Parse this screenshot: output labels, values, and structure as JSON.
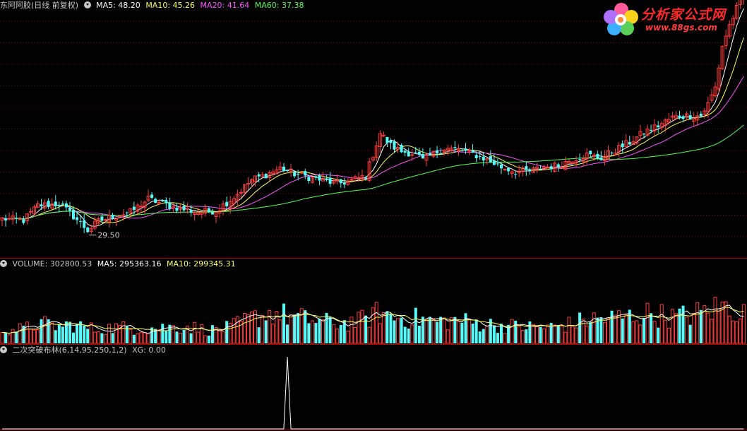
{
  "header1": {
    "title": "东阿阿胶(日线 前复权)",
    "ma5": "MA5: 48.20",
    "ma10": "MA10: 45.26",
    "ma20": "MA20: 41.64",
    "ma60": "MA60: 37.38"
  },
  "header2": {
    "volume": "VOLUME: 302800.53",
    "ma5": "MA5: 295363.16",
    "ma10": "MA10: 299345.31"
  },
  "header3": {
    "name": "二次突破布林(6,14,95,250,1,2)",
    "xg": "XG: 0.00"
  },
  "logo": {
    "title": "分析家公式网",
    "url": "www.88gs.com"
  },
  "colors": {
    "up": "#ff3c3c",
    "down": "#54fcfc",
    "ma5": "#ffffff",
    "ma10": "#ffff54",
    "ma20": "#ff54ff",
    "ma60": "#54ff54",
    "grid": "#8b0000",
    "divider": "#b00000"
  },
  "chart_data": {
    "type": "candlestick",
    "low_annotation": "29.50",
    "price_axis_range": [
      26.5,
      56.0
    ],
    "volume_axis_range": [
      0,
      750000
    ],
    "indicator_axis_range": [
      0,
      1
    ],
    "anchors": {
      "close": [
        [
          0,
          31.2
        ],
        [
          6,
          31.0
        ],
        [
          10,
          32.8
        ],
        [
          16,
          33.0
        ],
        [
          20,
          31.5
        ],
        [
          24,
          29.8
        ],
        [
          27,
          30.9
        ],
        [
          32,
          31.6
        ],
        [
          36,
          32.0
        ],
        [
          41,
          33.6
        ],
        [
          45,
          33.0
        ],
        [
          50,
          32.4
        ],
        [
          55,
          32.0
        ],
        [
          60,
          32.2
        ],
        [
          65,
          33.8
        ],
        [
          70,
          35.9
        ],
        [
          74,
          36.5
        ],
        [
          78,
          37.3
        ],
        [
          82,
          36.6
        ],
        [
          86,
          36.2
        ],
        [
          90,
          35.8
        ],
        [
          94,
          35.4
        ],
        [
          98,
          35.8
        ],
        [
          102,
          36.4
        ],
        [
          106,
          41.5
        ],
        [
          109,
          40.0
        ],
        [
          112,
          39.3
        ],
        [
          116,
          39.0
        ],
        [
          118,
          38.2
        ],
        [
          121,
          39.0
        ],
        [
          124,
          39.7
        ],
        [
          128,
          39.5
        ],
        [
          132,
          39.0
        ],
        [
          136,
          38.3
        ],
        [
          140,
          37.4
        ],
        [
          144,
          36.9
        ],
        [
          148,
          36.9
        ],
        [
          152,
          37.4
        ],
        [
          156,
          37.6
        ],
        [
          160,
          38.4
        ],
        [
          164,
          38.9
        ],
        [
          168,
          38.5
        ],
        [
          172,
          39.5
        ],
        [
          176,
          40.4
        ],
        [
          180,
          41.6
        ],
        [
          184,
          42.4
        ],
        [
          188,
          43.4
        ],
        [
          192,
          43.6
        ],
        [
          196,
          43.6
        ],
        [
          198,
          45.0
        ],
        [
          200,
          47.0
        ],
        [
          202,
          52.0
        ],
        [
          204,
          54.5
        ],
        [
          206,
          56.5
        ],
        [
          208,
          58.0
        ]
      ],
      "volume": [
        [
          0,
          150000
        ],
        [
          6,
          140000
        ],
        [
          10,
          200000
        ],
        [
          16,
          170000
        ],
        [
          20,
          190000
        ],
        [
          26,
          140000
        ],
        [
          32,
          160000
        ],
        [
          38,
          150000
        ],
        [
          45,
          160000
        ],
        [
          52,
          170000
        ],
        [
          58,
          130000
        ],
        [
          64,
          160000
        ],
        [
          70,
          250000
        ],
        [
          76,
          310000
        ],
        [
          82,
          260000
        ],
        [
          88,
          230000
        ],
        [
          94,
          200000
        ],
        [
          100,
          220000
        ],
        [
          106,
          310000
        ],
        [
          110,
          260000
        ],
        [
          116,
          250000
        ],
        [
          122,
          220000
        ],
        [
          128,
          230000
        ],
        [
          134,
          200000
        ],
        [
          140,
          180000
        ],
        [
          146,
          170000
        ],
        [
          152,
          160000
        ],
        [
          158,
          180000
        ],
        [
          164,
          240000
        ],
        [
          170,
          250000
        ],
        [
          176,
          270000
        ],
        [
          182,
          300000
        ],
        [
          188,
          260000
        ],
        [
          194,
          290000
        ],
        [
          198,
          330000
        ],
        [
          202,
          370000
        ],
        [
          206,
          340000
        ],
        [
          208,
          300000
        ]
      ]
    },
    "signal": [
      {
        "bar": 80,
        "value": 1
      }
    ]
  }
}
